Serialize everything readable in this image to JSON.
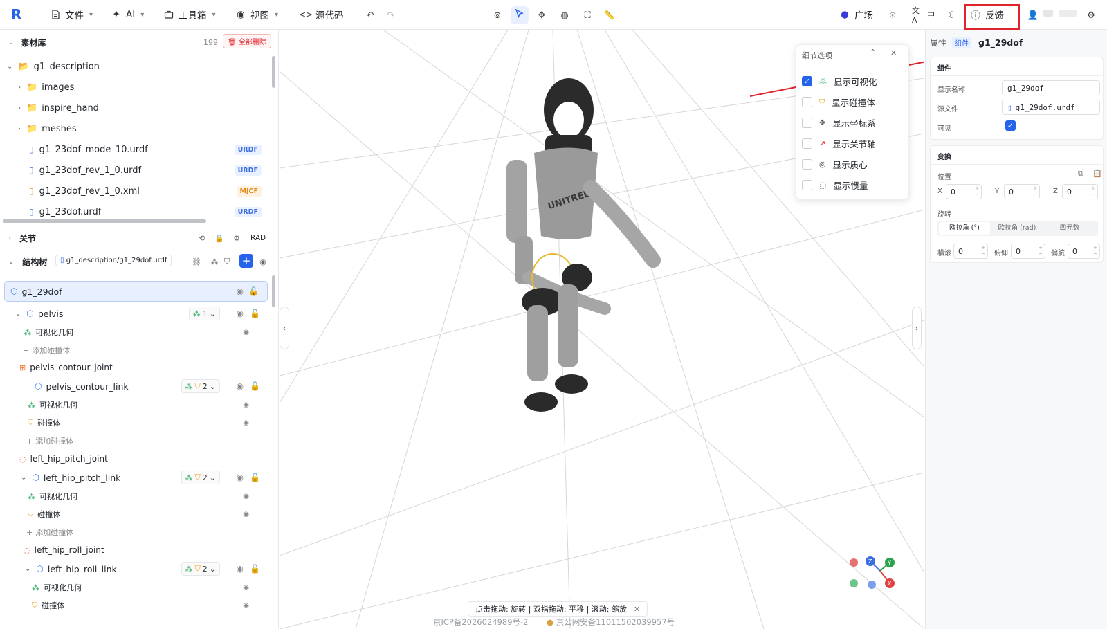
{
  "topbar": {
    "menus": [
      {
        "label": "文件"
      },
      {
        "label": "AI"
      },
      {
        "label": "工具箱"
      },
      {
        "label": "视图"
      },
      {
        "label": "源代码"
      }
    ],
    "square_label": "广场",
    "lang_label": "中",
    "feedback_label": "反馈"
  },
  "library": {
    "title": "素材库",
    "count": "199",
    "delete_all": "全部删除",
    "root_folder": "g1_description",
    "folders": [
      "images",
      "inspire_hand",
      "meshes"
    ],
    "files": [
      {
        "name": "g1_23dof_mode_10.urdf",
        "badge": "URDF"
      },
      {
        "name": "g1_23dof_rev_1_0.urdf",
        "badge": "URDF"
      },
      {
        "name": "g1_23dof_rev_1_0.xml",
        "badge": "MJCF"
      },
      {
        "name": "g1_23dof.urdf",
        "badge": "URDF"
      }
    ]
  },
  "joints": {
    "title": "关节",
    "unit": "RAD"
  },
  "structure": {
    "title": "结构树",
    "file": "g1_description/g1_29dof.urdf",
    "root": "g1_29dof",
    "nodes": [
      {
        "label": "pelvis",
        "kind": "link",
        "count": "1"
      },
      {
        "label": "可视化几何",
        "kind": "visual"
      },
      {
        "label": "添加碰撞体",
        "kind": "add"
      },
      {
        "label": "pelvis_contour_joint",
        "kind": "joint"
      },
      {
        "label": "pelvis_contour_link",
        "kind": "link",
        "count": "2"
      },
      {
        "label": "可视化几何",
        "kind": "visual"
      },
      {
        "label": "碰撞体",
        "kind": "collision"
      },
      {
        "label": "添加碰撞体",
        "kind": "add"
      },
      {
        "label": "left_hip_pitch_joint",
        "kind": "joint"
      },
      {
        "label": "left_hip_pitch_link",
        "kind": "link",
        "count": "2"
      },
      {
        "label": "可视化几何",
        "kind": "visual"
      },
      {
        "label": "碰撞体",
        "kind": "collision"
      },
      {
        "label": "添加碰撞体",
        "kind": "add"
      },
      {
        "label": "left_hip_roll_joint",
        "kind": "joint"
      },
      {
        "label": "left_hip_roll_link",
        "kind": "link",
        "count": "2"
      },
      {
        "label": "可视化几何",
        "kind": "visual"
      },
      {
        "label": "碰撞体",
        "kind": "collision"
      }
    ]
  },
  "detail": {
    "title": "细节选项",
    "options": [
      {
        "label": "显示可视化",
        "checked": true
      },
      {
        "label": "显示碰撞体",
        "checked": false
      },
      {
        "label": "显示坐标系",
        "checked": false
      },
      {
        "label": "显示关节轴",
        "checked": false
      },
      {
        "label": "显示质心",
        "checked": false
      },
      {
        "label": "显示惯量",
        "checked": false
      }
    ]
  },
  "viewport": {
    "hint": "点击拖动: 旋转 | 双指拖动: 平移 | 滚动: 缩放",
    "icp": "京ICP备2026024989号-2",
    "police": "京公网安备11011502039957号",
    "robot_brand": "UNITREE",
    "axes": {
      "x": "X",
      "y": "Y",
      "z": "Z"
    }
  },
  "properties": {
    "tab_label": "属性",
    "tag": "组件",
    "name": "g1_29dof",
    "component_section": "组件",
    "display_name_label": "显示名称",
    "display_name_value": "g1_29dof",
    "source_label": "源文件",
    "source_value": "g1_29dof.urdf",
    "visible_label": "可见",
    "transform_section": "变换",
    "position_label": "位置",
    "pos": {
      "x_label": "X",
      "x": "0",
      "y_label": "Y",
      "y": "0",
      "z_label": "Z",
      "z": "0"
    },
    "rotation_label": "旋转",
    "rot_tabs": [
      "欧拉角 (°)",
      "欧拉角 (rad)",
      "四元数"
    ],
    "rot": {
      "roll_label": "横滚",
      "roll": "0",
      "pitch_label": "俯仰",
      "pitch": "0",
      "yaw_label": "偏航",
      "yaw": "0"
    }
  },
  "colors": {
    "accent": "#2563eb",
    "annotation": "#e0242b"
  }
}
